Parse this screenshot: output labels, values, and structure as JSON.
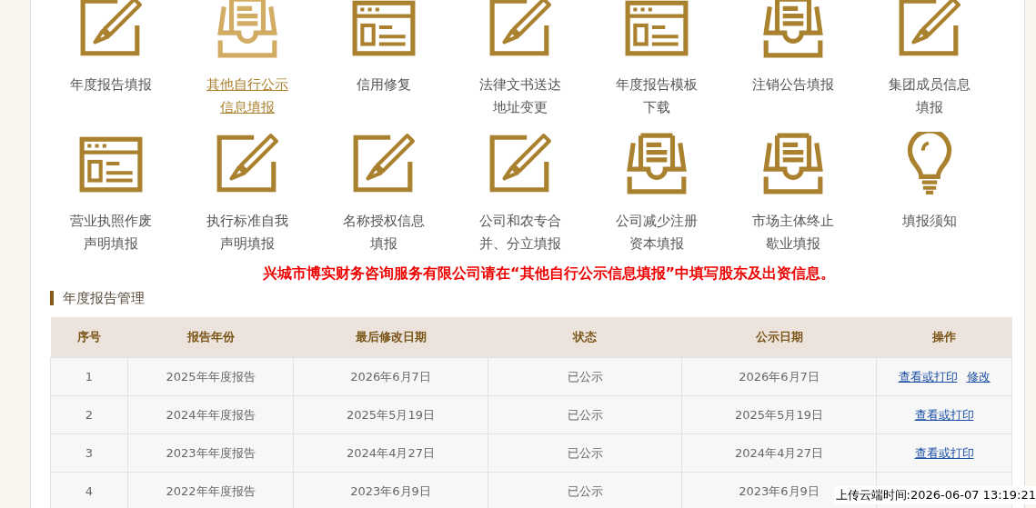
{
  "tiles": [
    {
      "label": "年度报告填报",
      "kind": "pencil",
      "selected": false
    },
    {
      "label": "其他自行公示信息填报",
      "kind": "tray",
      "selected": true
    },
    {
      "label": "信用修复",
      "kind": "form",
      "selected": false
    },
    {
      "label": "法律文书送达地址变更",
      "kind": "pencil",
      "selected": false
    },
    {
      "label": "年度报告模板下载",
      "kind": "form",
      "selected": false
    },
    {
      "label": "注销公告填报",
      "kind": "tray",
      "selected": false
    },
    {
      "label": "集团成员信息填报",
      "kind": "pencil",
      "selected": false
    },
    {
      "label": "营业执照作废声明填报",
      "kind": "form",
      "selected": false
    },
    {
      "label": "执行标准自我声明填报",
      "kind": "pencil",
      "selected": false
    },
    {
      "label": "名称授权信息填报",
      "kind": "pencil",
      "selected": false
    },
    {
      "label": "公司和农专合并、分立填报",
      "kind": "pencil",
      "selected": false
    },
    {
      "label": "公司减少注册资本填报",
      "kind": "tray",
      "selected": false
    },
    {
      "label": "市场主体终止歇业填报",
      "kind": "tray",
      "selected": false
    },
    {
      "label": "填报须知",
      "kind": "bulb",
      "selected": false
    }
  ],
  "notice": "兴城市博实财务咨询服务有限公司请在“其他自行公示信息填报”中填写股东及出资信息。",
  "section_title": "年度报告管理",
  "table": {
    "columns": [
      "序号",
      "报告年份",
      "最后修改日期",
      "状态",
      "公示日期",
      "操作"
    ],
    "rows": [
      {
        "cells": [
          "1",
          "2025年年度报告",
          "2026年6月7日",
          "已公示",
          "2026年6月7日"
        ],
        "actions": [
          "查看或打印",
          "修改"
        ]
      },
      {
        "cells": [
          "2",
          "2024年年度报告",
          "2025年5月19日",
          "已公示",
          "2025年5月19日"
        ],
        "actions": [
          "查看或打印"
        ]
      },
      {
        "cells": [
          "3",
          "2023年年度报告",
          "2024年4月27日",
          "已公示",
          "2024年4月27日"
        ],
        "actions": [
          "查看或打印"
        ]
      },
      {
        "cells": [
          "4",
          "2022年年度报告",
          "2023年6月9日",
          "已公示",
          "2023年6月9日"
        ]
      }
    ]
  },
  "upload_time": "上传云端时间:2026-06-07 13:19:21"
}
